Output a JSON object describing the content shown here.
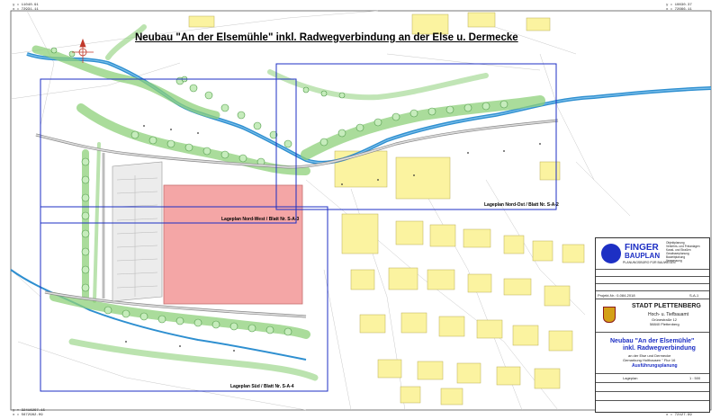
{
  "title": "Neubau \"An der Elsemühle\" inkl. Radwegverbindung an der Else u. Dermecke",
  "sheet_labels": {
    "nordwest": "Lageplan Nord-West / Blatt Nr. S-A-3",
    "nordost": "Lageplan Nord-Ost / Blatt Nr. S-A-2",
    "sued": "Lageplan Süd / Blatt Nr. S-A-4"
  },
  "corner_coords": {
    "top_left": "y = 11040.91\nx = 72931.11",
    "top_right": "y = 10830.37\nx = 72666.11",
    "bottom_left": "y = 32416297.15\nx = 5672982.09",
    "bottom_right": "y = 10678.01\nx = 72427.99"
  },
  "title_block": {
    "firm_name": "FINGER",
    "firm_name2": "BAUPLAN",
    "firm_sub": "PLANUNGSBÜRO FÜR BAUWESEN",
    "firm_services": "Objektplanung\nVerkehrs- und Freianlagen\nKanal- und Straßen\nGewässerplanung\nBauleitplanung\nVermessung",
    "project_no": "Projekt-Nr.: 0-084-2018",
    "client_name": "STADT PLETTENBERG",
    "client_dept": "Hoch- u. Tiefbauamt",
    "client_street": "Grünestraße 12",
    "client_city": "58840 Plettenberg",
    "project_line1": "Neubau \"An der Elsemühle\"",
    "project_line2": "inkl. Radwegverbindung",
    "project_line3": "an der Else und Dermecke",
    "project_line4": "Gemarkung Holthausen \" Flur 16",
    "project_phase": "Ausführungsplanung",
    "plan_type": "Lageplan",
    "scale": "1 : 500",
    "sheet_no": "S-A-1"
  },
  "colors": {
    "water": "#2e8fd0",
    "vegetation": "#8ed07a",
    "building_yellow": "#fbf3a0",
    "building_pink": "#f4a6a6",
    "sheet_frame": "#1d2fc4",
    "road": "#cfcfcf"
  }
}
